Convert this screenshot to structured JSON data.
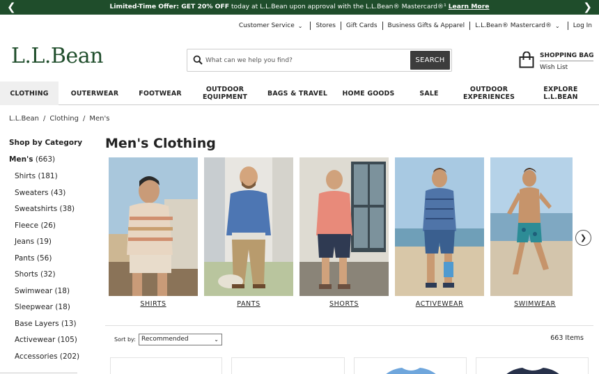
{
  "promo": {
    "prev_icon": "chevron-left-icon",
    "next_icon": "chevron-right-icon",
    "offer_bold": "Limited-Time Offer: GET 20% OFF",
    "offer_text": " today at L.L.Bean upon approval with the L.L.Bean® Mastercard®¹ ",
    "link": "Learn More"
  },
  "utility": {
    "customer_service": "Customer Service",
    "stores": "Stores",
    "gift_cards": "Gift Cards",
    "business_gifts": "Business Gifts & Apparel",
    "mastercard": "L.L.Bean® Mastercard®",
    "login": "Log In"
  },
  "brand": {
    "logo_text": "L.L.Bean",
    "color": "#1f4d2b"
  },
  "search": {
    "placeholder": "What can we help you find?",
    "value": "",
    "button": "SEARCH"
  },
  "bag": {
    "title": "SHOPPING BAG",
    "wishlist": "Wish List"
  },
  "nav": {
    "items": [
      {
        "label": "CLOTHING",
        "active": true
      },
      {
        "label": "OUTERWEAR"
      },
      {
        "label": "FOOTWEAR"
      },
      {
        "label": "OUTDOOR\nEQUIPMENT"
      },
      {
        "label": "BAGS & TRAVEL"
      },
      {
        "label": "HOME GOODS"
      },
      {
        "label": "SALE"
      },
      {
        "label": "OUTDOOR\nEXPERIENCES"
      },
      {
        "label": "EXPLORE\nL.L.BEAN"
      }
    ]
  },
  "breadcrumb": [
    "L.L.Bean",
    "Clothing",
    "Men's"
  ],
  "sidebar": {
    "heading": "Shop by Category",
    "root_label": "Men's",
    "root_count": "(663)",
    "items": [
      "Shirts (181)",
      "Sweaters (43)",
      "Sweatshirts (38)",
      "Fleece (26)",
      "Jeans (19)",
      "Pants (56)",
      "Shorts (32)",
      "Swimwear (18)",
      "Sleepwear (18)",
      "Base Layers (13)",
      "Activewear (105)",
      "Accessories (202)"
    ]
  },
  "page_title": "Men's Clothing",
  "categories": [
    {
      "label": "SHIRTS"
    },
    {
      "label": "PANTS"
    },
    {
      "label": "SHORTS"
    },
    {
      "label": "ACTIVEWEAR"
    },
    {
      "label": "SWIMWEAR"
    }
  ],
  "sort": {
    "label": "Sort by:",
    "selected": "Recommended"
  },
  "item_count": "663 Items"
}
